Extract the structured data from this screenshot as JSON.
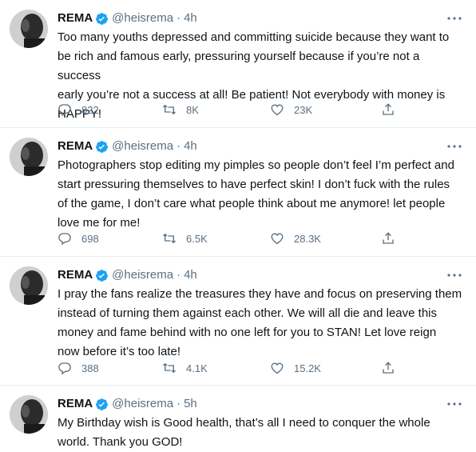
{
  "colors": {
    "text": "#0f1419",
    "secondary": "#5b7083",
    "verified": "#1da1f2",
    "divider": "#e6ecf0"
  },
  "tweets": [
    {
      "name": "REMA",
      "handle": "@heisrema",
      "time": "4h",
      "text": "Too many youths depressed and committing suicide because they want to\nbe rich and famous early, pressuring yourself because if you’re not a success\nearly you’re not a success at all! Be patient! Not everybody with money is\nHAPPY!",
      "replies": "822",
      "retweets": "8K",
      "likes": "23K"
    },
    {
      "name": "REMA",
      "handle": "@heisrema",
      "time": "4h",
      "text": "Photographers stop editing my pimples so people don’t feel I’m perfect and\nstart pressuring themselves to have perfect skin! I don’t fuck with the rules\nof the game, I don’t care what people think about me anymore! let people\nlove me for me!",
      "replies": "698",
      "retweets": "6.5K",
      "likes": "28.3K"
    },
    {
      "name": "REMA",
      "handle": "@heisrema",
      "time": "4h",
      "text": "I pray the fans realize the treasures they have and focus on preserving them\ninstead of turning them against each other. We will all die and leave this\nmoney and fame behind with no one left for you to STAN! Let love reign\nnow before it’s too late!",
      "replies": "388",
      "retweets": "4.1K",
      "likes": "15.2K"
    },
    {
      "name": "REMA",
      "handle": "@heisrema",
      "time": "5h",
      "text": "My Birthday wish is Good health, that’s all I need to conquer the whole\nworld. Thank you GOD!"
    }
  ]
}
